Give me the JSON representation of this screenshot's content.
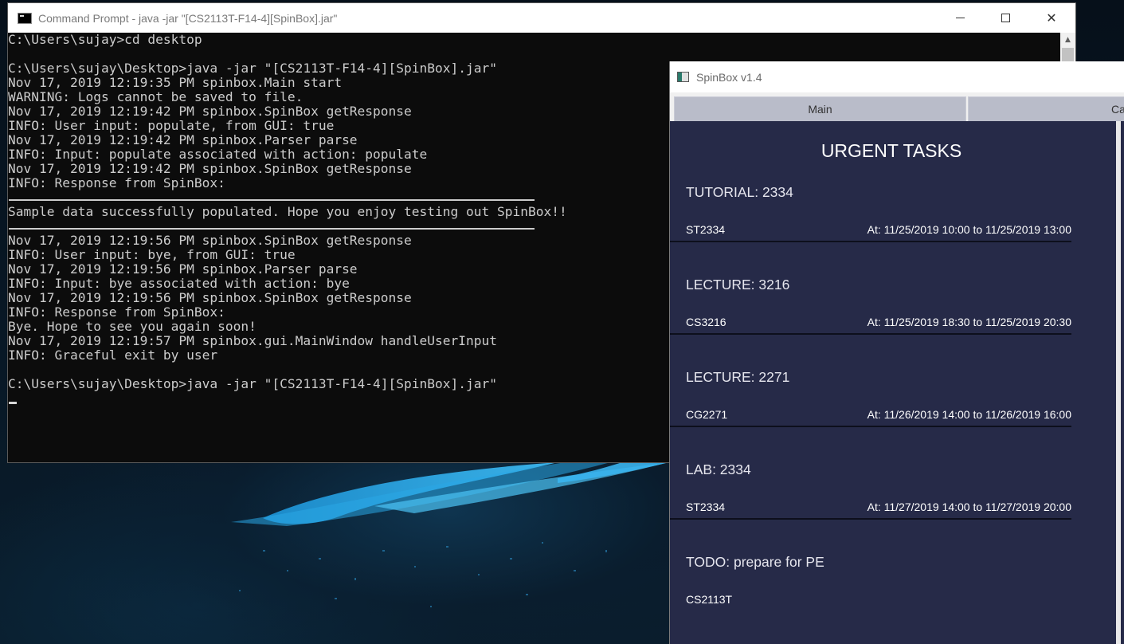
{
  "cmd": {
    "title": "Command Prompt - java  -jar \"[CS2113T-F14-4][SpinBox].jar\"",
    "lines": [
      "C:\\Users\\sujay>cd desktop",
      "",
      "C:\\Users\\sujay\\Desktop>java -jar \"[CS2113T-F14-4][SpinBox].jar\"",
      "Nov 17, 2019 12:19:35 PM spinbox.Main start",
      "WARNING: Logs cannot be saved to file.",
      "Nov 17, 2019 12:19:42 PM spinbox.SpinBox getResponse",
      "INFO: User input: populate, from GUI: true",
      "Nov 17, 2019 12:19:42 PM spinbox.Parser parse",
      "INFO: Input: populate associated with action: populate",
      "Nov 17, 2019 12:19:42 PM spinbox.SpinBox getResponse",
      "INFO: Response from SpinBox:",
      "",
      "Sample data successfully populated. Hope you enjoy testing out SpinBox!!",
      "",
      "Nov 17, 2019 12:19:56 PM spinbox.SpinBox getResponse",
      "INFO: User input: bye, from GUI: true",
      "Nov 17, 2019 12:19:56 PM spinbox.Parser parse",
      "INFO: Input: bye associated with action: bye",
      "Nov 17, 2019 12:19:56 PM spinbox.SpinBox getResponse",
      "INFO: Response from SpinBox:",
      "Bye. Hope to see you again soon!",
      "Nov 17, 2019 12:19:57 PM spinbox.gui.MainWindow handleUserInput",
      "INFO: Graceful exit by user",
      "",
      "C:\\Users\\sujay\\Desktop>java -jar \"[CS2113T-F14-4][SpinBox].jar\""
    ],
    "divider_line_indices": [
      11,
      13
    ]
  },
  "spinbox": {
    "title": "SpinBox v1.4",
    "tabs": [
      {
        "label": "Main"
      },
      {
        "label": "Calen"
      }
    ],
    "heading": "URGENT TASKS",
    "tasks": [
      {
        "title": "TUTORIAL: 2334",
        "module": "ST2334",
        "time": "At: 11/25/2019 10:00 to 11/25/2019 13:00"
      },
      {
        "title": "LECTURE: 3216",
        "module": "CS3216",
        "time": "At: 11/25/2019 18:30 to 11/25/2019 20:30"
      },
      {
        "title": "LECTURE: 2271",
        "module": "CG2271",
        "time": "At: 11/26/2019 14:00 to 11/26/2019 16:00"
      },
      {
        "title": "LAB: 2334",
        "module": "ST2334",
        "time": "At: 11/27/2019 14:00 to 11/27/2019 20:00"
      },
      {
        "title": "TODO: prepare for PE",
        "module": "CS2113T",
        "time": ""
      }
    ]
  },
  "colors": {
    "terminal_bg": "#0c0c0c",
    "terminal_text": "#cccccc",
    "spinbox_bg": "#262a48",
    "tab_bg": "#b9bcc9",
    "wallpaper_accent": "#2aa7e6"
  }
}
